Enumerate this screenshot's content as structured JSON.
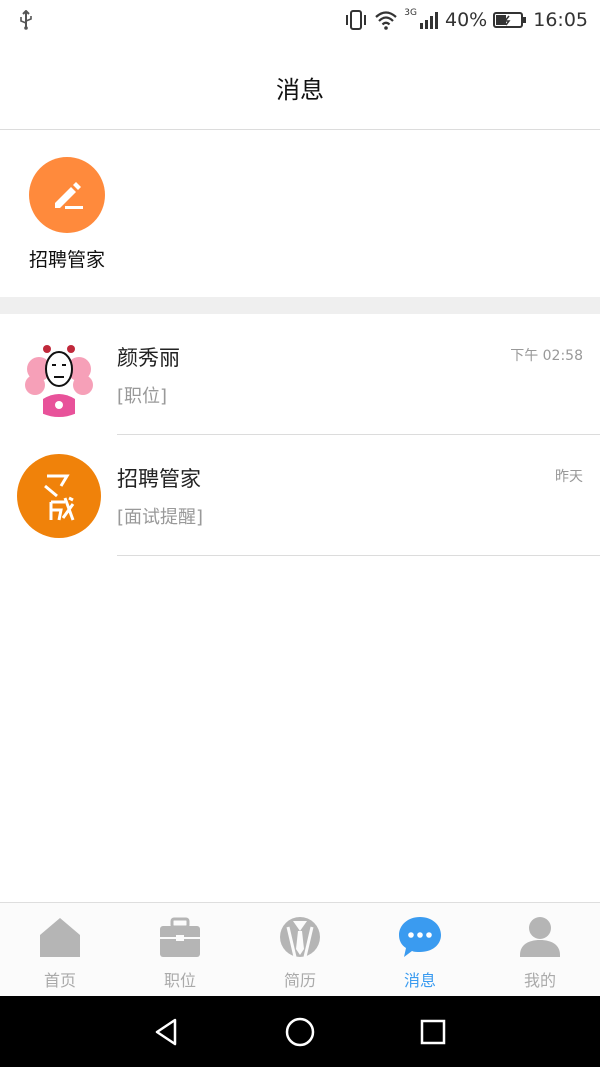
{
  "status_bar": {
    "battery": "40%",
    "time": "16:05",
    "network": "3G"
  },
  "header": {
    "title": "消息"
  },
  "quick_entries": [
    {
      "label": "招聘管家",
      "icon": "edit-icon",
      "color": "#ff8a3c"
    }
  ],
  "messages": [
    {
      "name": "颜秀丽",
      "preview": "[职位]",
      "time": "下午 02:58",
      "avatar": "cartoon-avatar"
    },
    {
      "name": "招聘管家",
      "preview": "[面试提醒]",
      "time": "昨天",
      "avatar": "brand-logo-avatar",
      "avatar_color": "#f0820a"
    }
  ],
  "tabbar": {
    "active_color": "#3a9bf0",
    "inactive_color": "#aaaaaa",
    "items": [
      {
        "label": "首页",
        "icon": "home-icon"
      },
      {
        "label": "职位",
        "icon": "briefcase-icon"
      },
      {
        "label": "简历",
        "icon": "resume-icon"
      },
      {
        "label": "消息",
        "icon": "chat-icon",
        "active": true
      },
      {
        "label": "我的",
        "icon": "user-icon"
      }
    ]
  },
  "system_nav": {
    "buttons": [
      "back-icon",
      "home-circle-icon",
      "recents-icon"
    ]
  }
}
